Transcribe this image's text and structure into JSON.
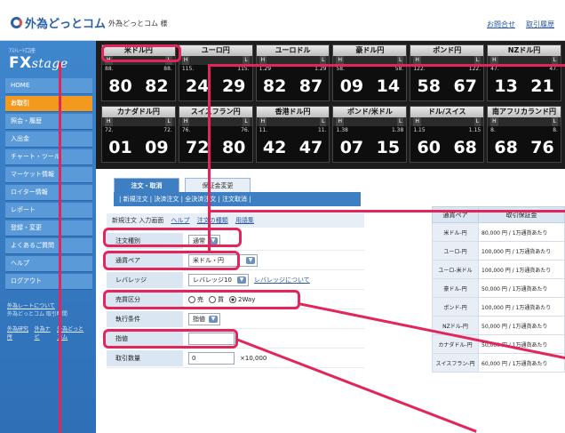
{
  "header": {
    "logo": "外為どっとコム",
    "user": "外為どっとコム 様",
    "links": [
      "お問合せ",
      "取引履歴"
    ]
  },
  "sidebar": {
    "brand_small": "ｱｽﾄﾚｰﾄ口座",
    "brand_fx": "FX",
    "brand_stage": "stage",
    "items": [
      {
        "label": "HOME",
        "active": false
      },
      {
        "label": "お取引",
        "active": true
      },
      {
        "label": "照会・履歴",
        "active": false
      },
      {
        "label": "入出金",
        "active": false
      },
      {
        "label": "チャート・ツール",
        "active": false
      },
      {
        "label": "マーケット情報",
        "active": false
      },
      {
        "label": "ロイター情報",
        "active": false
      },
      {
        "label": "レポート",
        "active": false
      },
      {
        "label": "登録・変更",
        "active": false
      },
      {
        "label": "よくあるご質問",
        "active": false
      },
      {
        "label": "ヘルプ",
        "active": false
      },
      {
        "label": "ログアウト",
        "active": false
      }
    ],
    "foot_link": "外為レートについて",
    "foot_text": "外為どっとコム 取引時間",
    "foot_links": [
      "外為研究所",
      "外為ナビ",
      "外為どっとコム"
    ]
  },
  "rates": [
    {
      "pair": "米ドル円",
      "l1": "88.",
      "l2": "88.",
      "bid": "80",
      "ask": "82"
    },
    {
      "pair": "ユーロ円",
      "l1": "115.",
      "l2": "115.",
      "bid": "24",
      "ask": "29"
    },
    {
      "pair": "ユーロドル",
      "l1": "1.29",
      "l2": "1.29",
      "bid": "82",
      "ask": "87"
    },
    {
      "pair": "豪ドル円",
      "l1": "58.",
      "l2": "58.",
      "bid": "09",
      "ask": "14"
    },
    {
      "pair": "ポンド円",
      "l1": "122.",
      "l2": "122.",
      "bid": "58",
      "ask": "67"
    },
    {
      "pair": "NZドル円",
      "l1": "47.",
      "l2": "47.",
      "bid": "13",
      "ask": "21"
    },
    {
      "pair": "カナダドル円",
      "l1": "72.",
      "l2": "72.",
      "bid": "01",
      "ask": "09"
    },
    {
      "pair": "スイスフラン円",
      "l1": "76.",
      "l2": "76.",
      "bid": "72",
      "ask": "80"
    },
    {
      "pair": "香港ドル円",
      "l1": "11.",
      "l2": "11.",
      "bid": "42",
      "ask": "47"
    },
    {
      "pair": "ポンド/米ドル",
      "l1": "1.38",
      "l2": "1.38",
      "bid": "07",
      "ask": "15"
    },
    {
      "pair": "ドル/スイス",
      "l1": "1.15",
      "l2": "1.15",
      "bid": "60",
      "ask": "68"
    },
    {
      "pair": "南アフリカランド円",
      "l1": "8.",
      "l2": "8.",
      "bid": "68",
      "ask": "76"
    }
  ],
  "tabs": [
    "注文・取消",
    "保証金変更"
  ],
  "subnav": "| 新規注文 | 決済注文 | 全決済注文 | 注文取消 |",
  "form_title": "新規注文 入力画面",
  "form_title_links": [
    "ヘルプ",
    "注文の種類",
    "用語集"
  ],
  "form": {
    "order_type_label": "注文種別",
    "order_type_value": "通常",
    "pair_label": "通貨ペア",
    "pair_value": "米ドル・円",
    "leverage_label": "レバレッジ",
    "leverage_value": "レバレッジ10",
    "leverage_link": "レバレッジについて",
    "side_label": "売買区分",
    "side_options": [
      "売",
      "買",
      "2Way"
    ],
    "cond_label": "執行条件",
    "cond_value": "指値",
    "price_label": "指値",
    "price_value": "",
    "qty_label": "取引数量",
    "qty_value": "0",
    "qty_unit": "×10,000"
  },
  "margin_table": {
    "headers": [
      "通貨ペア",
      "取引保証金"
    ],
    "rows": [
      [
        "米ドル-円",
        "80,000 円 / 1万通貨あたり"
      ],
      [
        "ユーロ-円",
        "100,000 円 / 1万通貨あたり"
      ],
      [
        "ユーロ-米ドル",
        "100,000 円 / 1万通貨あたり"
      ],
      [
        "豪ドル-円",
        "50,000 円 / 1万通貨あたり"
      ],
      [
        "ポンド-円",
        "100,000 円 / 1万通貨あたり"
      ],
      [
        "NZドル-円",
        "50,000 円 / 1万通貨あたり"
      ],
      [
        "カナダドル-円",
        "50,000 円 / 1万通貨あたり"
      ],
      [
        "スイスフラン-円",
        "60,000 円 / 1万通貨あたり"
      ]
    ]
  },
  "colors": {
    "accent": "#3e7fc4",
    "active": "#f39a1e",
    "callout": "#e2265b"
  }
}
